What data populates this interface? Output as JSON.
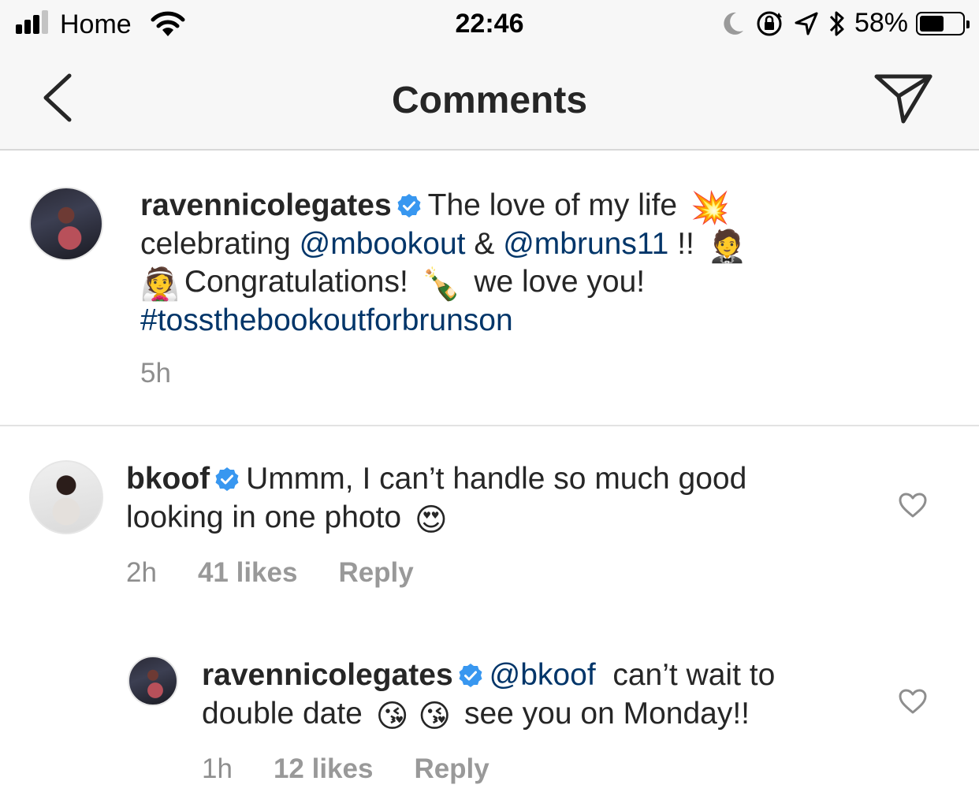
{
  "status_bar": {
    "carrier": "Home",
    "time": "22:46",
    "battery_percent_label": "58%",
    "battery_level": 0.58,
    "signal_bars": 3,
    "icons": [
      "signal-icon",
      "wifi-icon",
      "moon-icon",
      "rotation-lock-icon",
      "location-icon",
      "bluetooth-icon",
      "battery-icon"
    ]
  },
  "nav": {
    "title": "Comments",
    "back_icon": "chevron-left-icon",
    "send_icon": "paper-plane-icon"
  },
  "post": {
    "username": "ravennicolegates",
    "text_1": "The love of my life",
    "emoji_1": "💥",
    "text_2": "celebrating",
    "mention_1": "@mbookout",
    "text_3": "&",
    "mention_2": "@mbruns11",
    "text_4": "!!",
    "emoji_2": "🤵",
    "emoji_3": "👰",
    "text_5": "Congratulations!",
    "emoji_4": "🍾",
    "text_6": "we love you!",
    "hashtag": "#tossthebookoutforbrunson",
    "time": "5h"
  },
  "comments": [
    {
      "username": "bkoof",
      "text_1": "Ummm, I can’t handle so much good",
      "text_2": "looking in one photo",
      "emoji": "😍",
      "time": "2h",
      "likes": "41 likes",
      "reply": "Reply"
    },
    {
      "username": "ravennicolegates",
      "mention": "@bkoof",
      "text_1": "can’t wait to",
      "text_2": "double date",
      "emoji_1": "😘",
      "emoji_2": "😘",
      "text_3": "see you on Monday!!",
      "time": "1h",
      "likes": "12 likes",
      "reply": "Reply"
    }
  ],
  "colors": {
    "bar_background": "#f7f7f7",
    "text": "#262626",
    "secondary_text": "#8e8e8e",
    "link": "#003569",
    "verified": "#3897f0"
  }
}
